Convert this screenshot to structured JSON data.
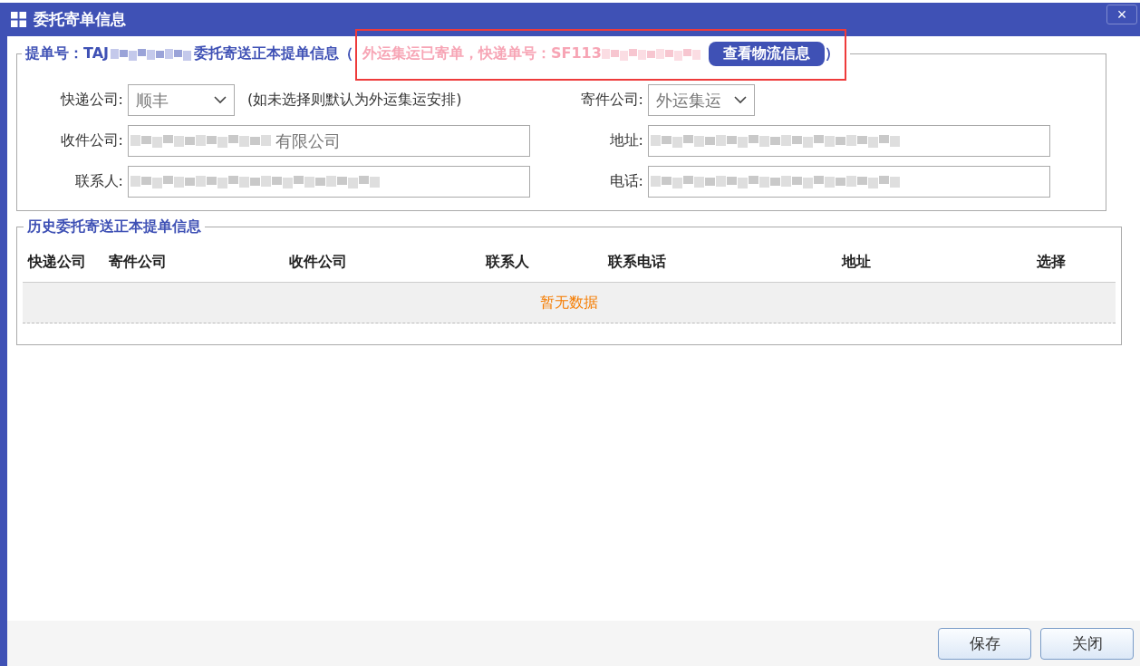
{
  "window": {
    "title": "委托寄单信息",
    "close": "×"
  },
  "current": {
    "legend_prefix": "提单号：TAJ",
    "legend_prefix_redacted": true,
    "legend_title": "委托寄送正本提单信息",
    "open_paren": "（",
    "status": "外运集运已寄单，快递单号：SF113",
    "status_redacted": true,
    "track_button": "查看物流信息",
    "close_paren": "）",
    "highlighted": true,
    "rows": [
      [
        {
          "kind": "select",
          "label": "快递公司:",
          "value": "顺丰",
          "note": "(如未选择则默认为外运集运安排)"
        },
        {
          "kind": "select",
          "label": "寄件公司:",
          "value": "外运集运"
        }
      ],
      [
        {
          "kind": "input",
          "label": "收件公司:",
          "redacted": true,
          "value": "有限公司"
        },
        {
          "kind": "input",
          "label": "地址:",
          "redacted": true
        }
      ],
      [
        {
          "kind": "input",
          "label": "联系人:",
          "redacted": true
        },
        {
          "kind": "input",
          "label": "电话:",
          "redacted": true
        }
      ]
    ]
  },
  "history": {
    "title": "历史委托寄送正本提单信息",
    "columns": [
      "快递公司",
      "寄件公司",
      "收件公司",
      "联系人",
      "联系电话",
      "地址",
      "选择"
    ],
    "empty_text": "暂无数据"
  },
  "buttons": [
    "保存",
    "关闭"
  ]
}
